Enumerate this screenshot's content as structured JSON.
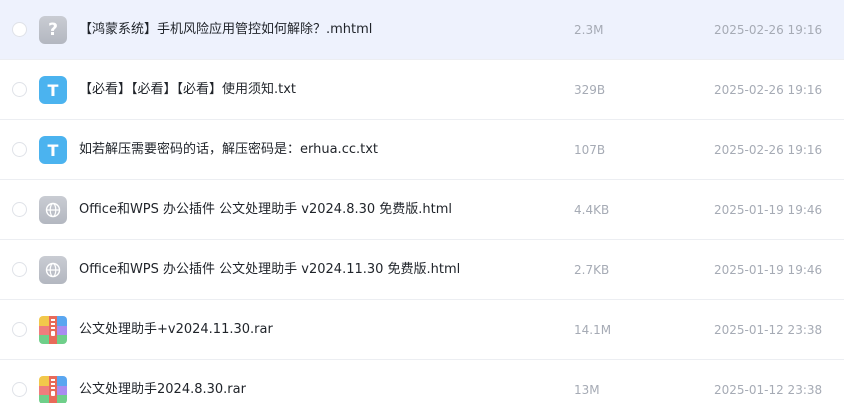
{
  "files": [
    {
      "icon": "unknown-file-icon",
      "glyph": "?",
      "name": "【鸿蒙系统】手机风险应用管控如何解除？.mhtml",
      "size": "2.3M",
      "date": "2025-02-26 19:16"
    },
    {
      "icon": "text-file-icon",
      "glyph": "T",
      "name": "【必看】【必看】【必看】使用须知.txt",
      "size": "329B",
      "date": "2025-02-26 19:16"
    },
    {
      "icon": "text-file-icon",
      "glyph": "T",
      "name": "如若解压需要密码的话，解压密码是：erhua.cc.txt",
      "size": "107B",
      "date": "2025-02-26 19:16"
    },
    {
      "icon": "web-file-icon",
      "glyph": "",
      "name": "Office和WPS 办公插件 公文处理助手 v2024.8.30 免费版.html",
      "size": "4.4KB",
      "date": "2025-01-19 19:46"
    },
    {
      "icon": "web-file-icon",
      "glyph": "",
      "name": "Office和WPS 办公插件 公文处理助手 v2024.11.30 免费版.html",
      "size": "2.7KB",
      "date": "2025-01-19 19:46"
    },
    {
      "icon": "rar-archive-icon",
      "glyph": "",
      "name": "公文处理助手+v2024.11.30.rar",
      "size": "14.1M",
      "date": "2025-01-12 23:38"
    },
    {
      "icon": "rar-archive-icon",
      "glyph": "",
      "name": "公文处理助手2024.8.30.rar",
      "size": "13M",
      "date": "2025-01-12 23:38"
    }
  ],
  "colors": {
    "selected_row": "#eef2fd",
    "text_icon": "#4bb3ef",
    "muted": "#a6abb5"
  }
}
